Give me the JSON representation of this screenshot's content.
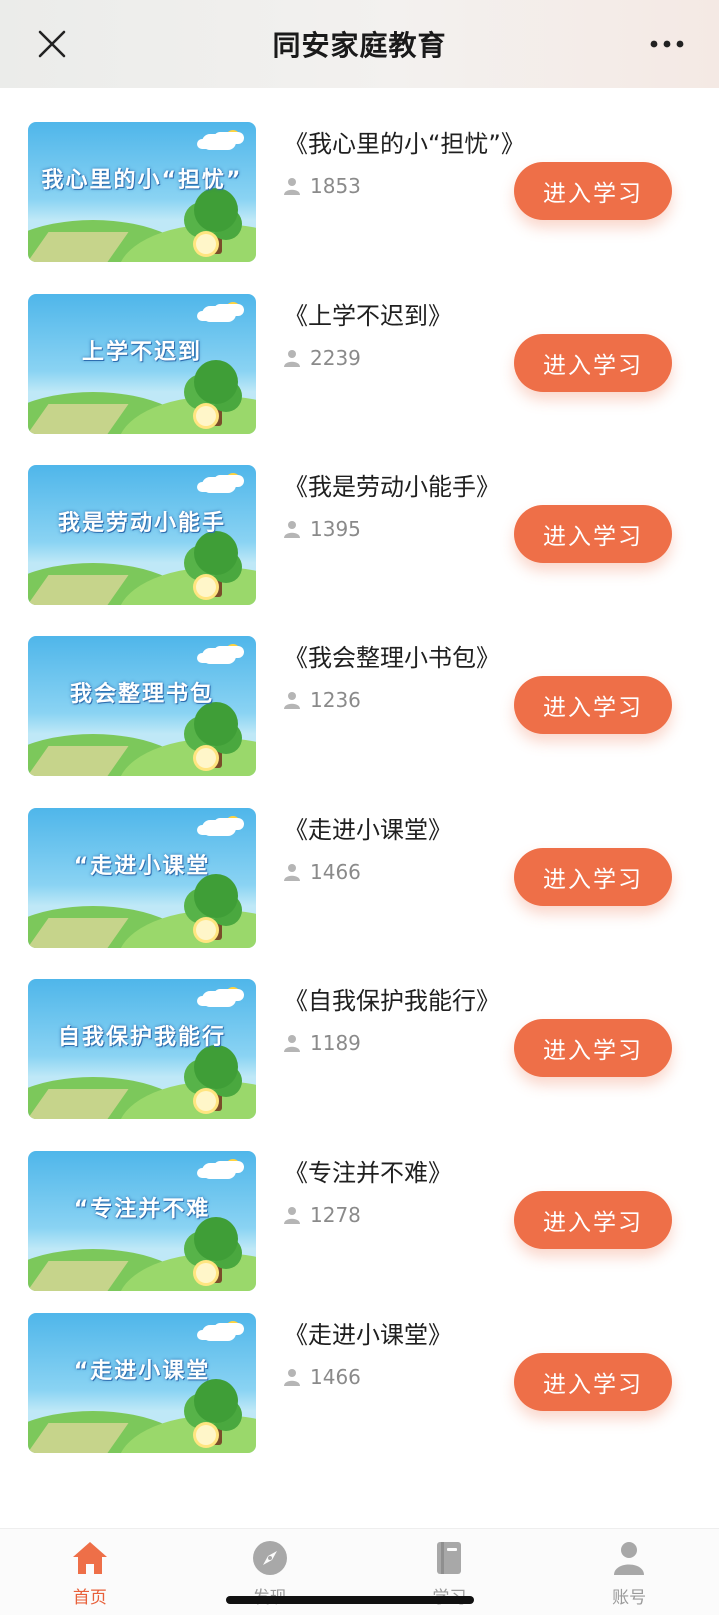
{
  "header": {
    "title": "同安家庭教育",
    "close_icon": "close-icon",
    "more_icon": "more-icon"
  },
  "courses": [
    {
      "title": "《我心里的小“担忧”》",
      "views": "1853",
      "button": "进入学习",
      "thumb_text": "我心里的小“担忧”"
    },
    {
      "title": "《上学不迟到》",
      "views": "2239",
      "button": "进入学习",
      "thumb_text": "上学不迟到"
    },
    {
      "title": "《我是劳动小能手》",
      "views": "1395",
      "button": "进入学习",
      "thumb_text": "我是劳动小能手"
    },
    {
      "title": "《我会整理小书包》",
      "views": "1236",
      "button": "进入学习",
      "thumb_text": "我会整理书包"
    },
    {
      "title": "《走进小课堂》",
      "views": "1466",
      "button": "进入学习",
      "thumb_text": "“走进小课堂"
    },
    {
      "title": "《自我保护我能行》",
      "views": "1189",
      "button": "进入学习",
      "thumb_text": "自我保护我能行"
    },
    {
      "title": "《专注并不难》",
      "views": "1278",
      "button": "进入学习",
      "thumb_text": "“专注并不难"
    },
    {
      "title": "《走进小课堂》",
      "views": "1466",
      "button": "进入学习",
      "thumb_text": "“走进小课堂"
    }
  ],
  "tabbar": {
    "items": [
      {
        "label": "首页",
        "icon": "home-icon",
        "active": true
      },
      {
        "label": "发现",
        "icon": "compass-icon",
        "active": false
      },
      {
        "label": "学习",
        "icon": "book-icon",
        "active": false
      },
      {
        "label": "账号",
        "icon": "user-icon",
        "active": false
      }
    ]
  },
  "colors": {
    "accent": "#ee6f48",
    "active_tab": "#e8603a",
    "inactive_tab": "#9a9a9a"
  }
}
